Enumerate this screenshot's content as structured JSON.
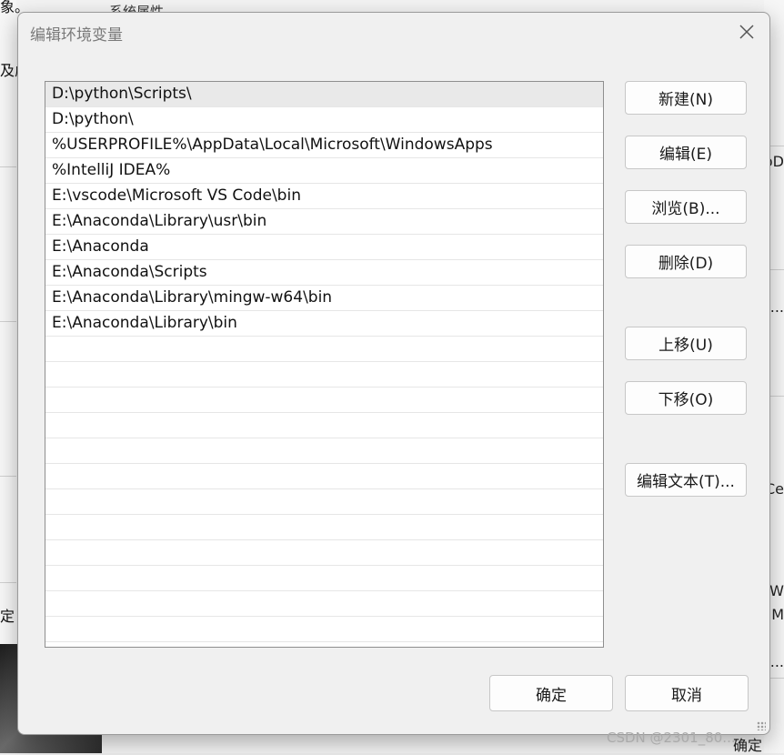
{
  "background": {
    "left_texts": [
      "象。",
      "及虚",
      "定"
    ],
    "right_texts": [
      "pD",
      ")...",
      "Ce",
      "OW",
      "· M",
      "...",
      "确定"
    ],
    "top_text": "系统属性"
  },
  "dialog": {
    "title": "编辑环境变量",
    "close_icon": "close-icon",
    "paths": [
      "D:\\python\\Scripts\\",
      "D:\\python\\",
      "%USERPROFILE%\\AppData\\Local\\Microsoft\\WindowsApps",
      "%IntelliJ IDEA%",
      "E:\\vscode\\Microsoft VS Code\\bin",
      "E:\\Anaconda\\Library\\usr\\bin",
      "E:\\Anaconda",
      "E:\\Anaconda\\Scripts",
      "E:\\Anaconda\\Library\\mingw-w64\\bin",
      "E:\\Anaconda\\Library\\bin"
    ],
    "buttons": {
      "new": "新建(N)",
      "edit": "编辑(E)",
      "browse": "浏览(B)...",
      "delete": "删除(D)",
      "move_up": "上移(U)",
      "move_down": "下移(O)",
      "edit_text": "编辑文本(T)...",
      "ok": "确定",
      "cancel": "取消"
    }
  },
  "watermark": "CSDN @2301_80..."
}
